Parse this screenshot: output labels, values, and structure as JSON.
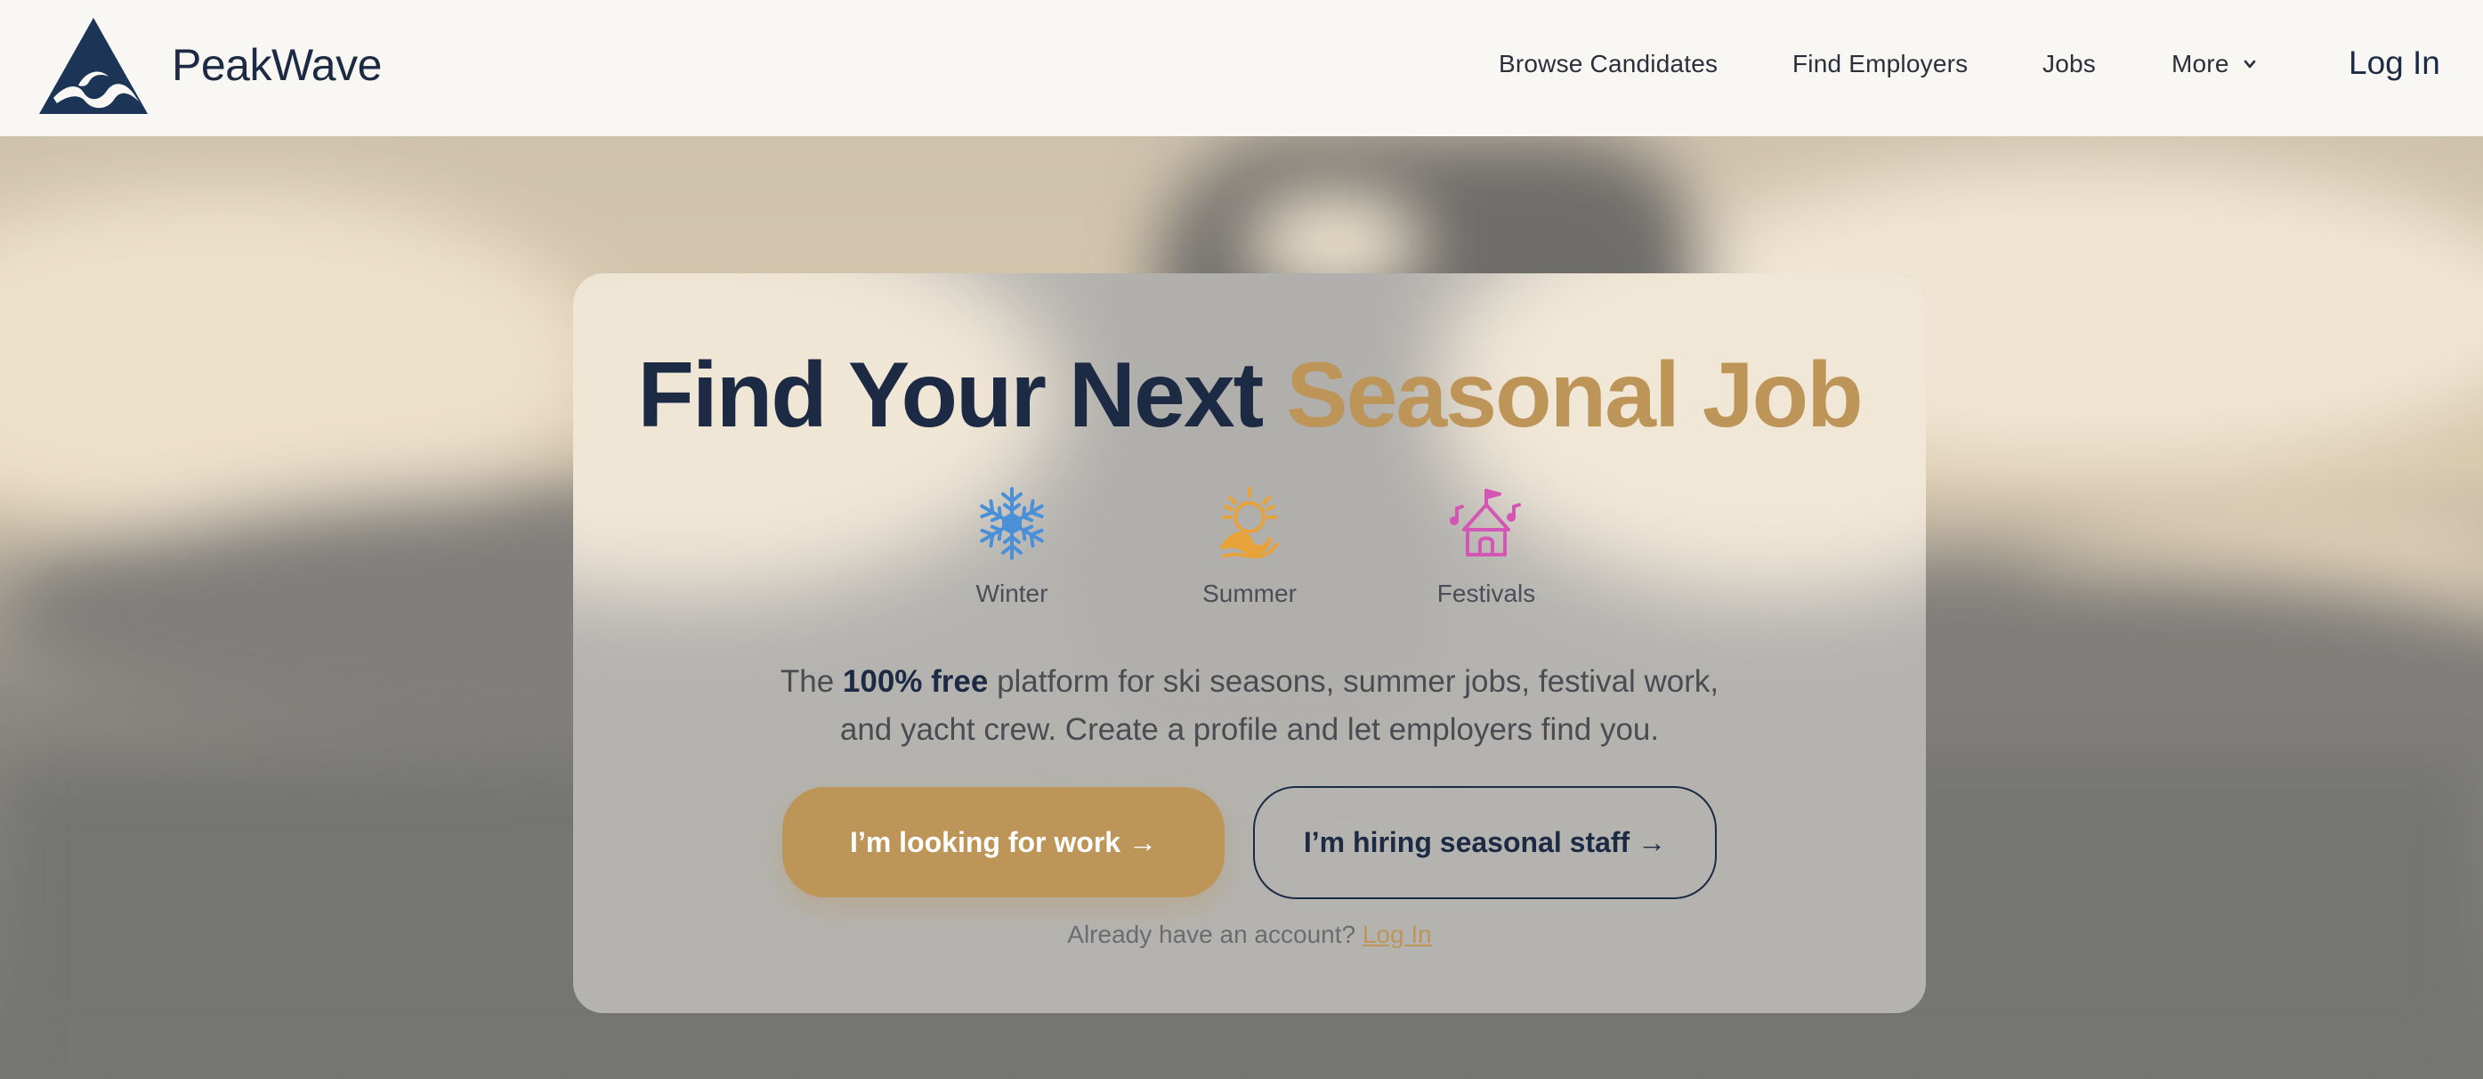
{
  "brand": {
    "name": "PeakWave",
    "primary_color": "#1c2a44",
    "accent_color": "#be9558"
  },
  "nav": {
    "links": [
      "Browse Candidates",
      "Find Employers",
      "Jobs"
    ],
    "more_label": "More",
    "login_label": "Log In"
  },
  "hero": {
    "headline_main": "Find Your Next ",
    "headline_accent": "Seasonal Job",
    "seasons": [
      {
        "label": "Winter",
        "icon": "snowflake-icon",
        "color": "#4a90d9"
      },
      {
        "label": "Summer",
        "icon": "sun-wave-icon",
        "color": "#e8a23a"
      },
      {
        "label": "Festivals",
        "icon": "festival-tent-icon",
        "color": "#d455b4"
      }
    ],
    "description_prefix": "The ",
    "description_bold": "100% free",
    "description_line1_rest": " platform for ski seasons, summer jobs, festival work,",
    "description_line2": "and yacht crew. Create a profile and let employers find you.",
    "cta_primary": "I’m looking for work →",
    "cta_secondary": "I’m hiring seasonal staff →",
    "account_prompt": "Already have an account?",
    "account_link": "Log In"
  }
}
